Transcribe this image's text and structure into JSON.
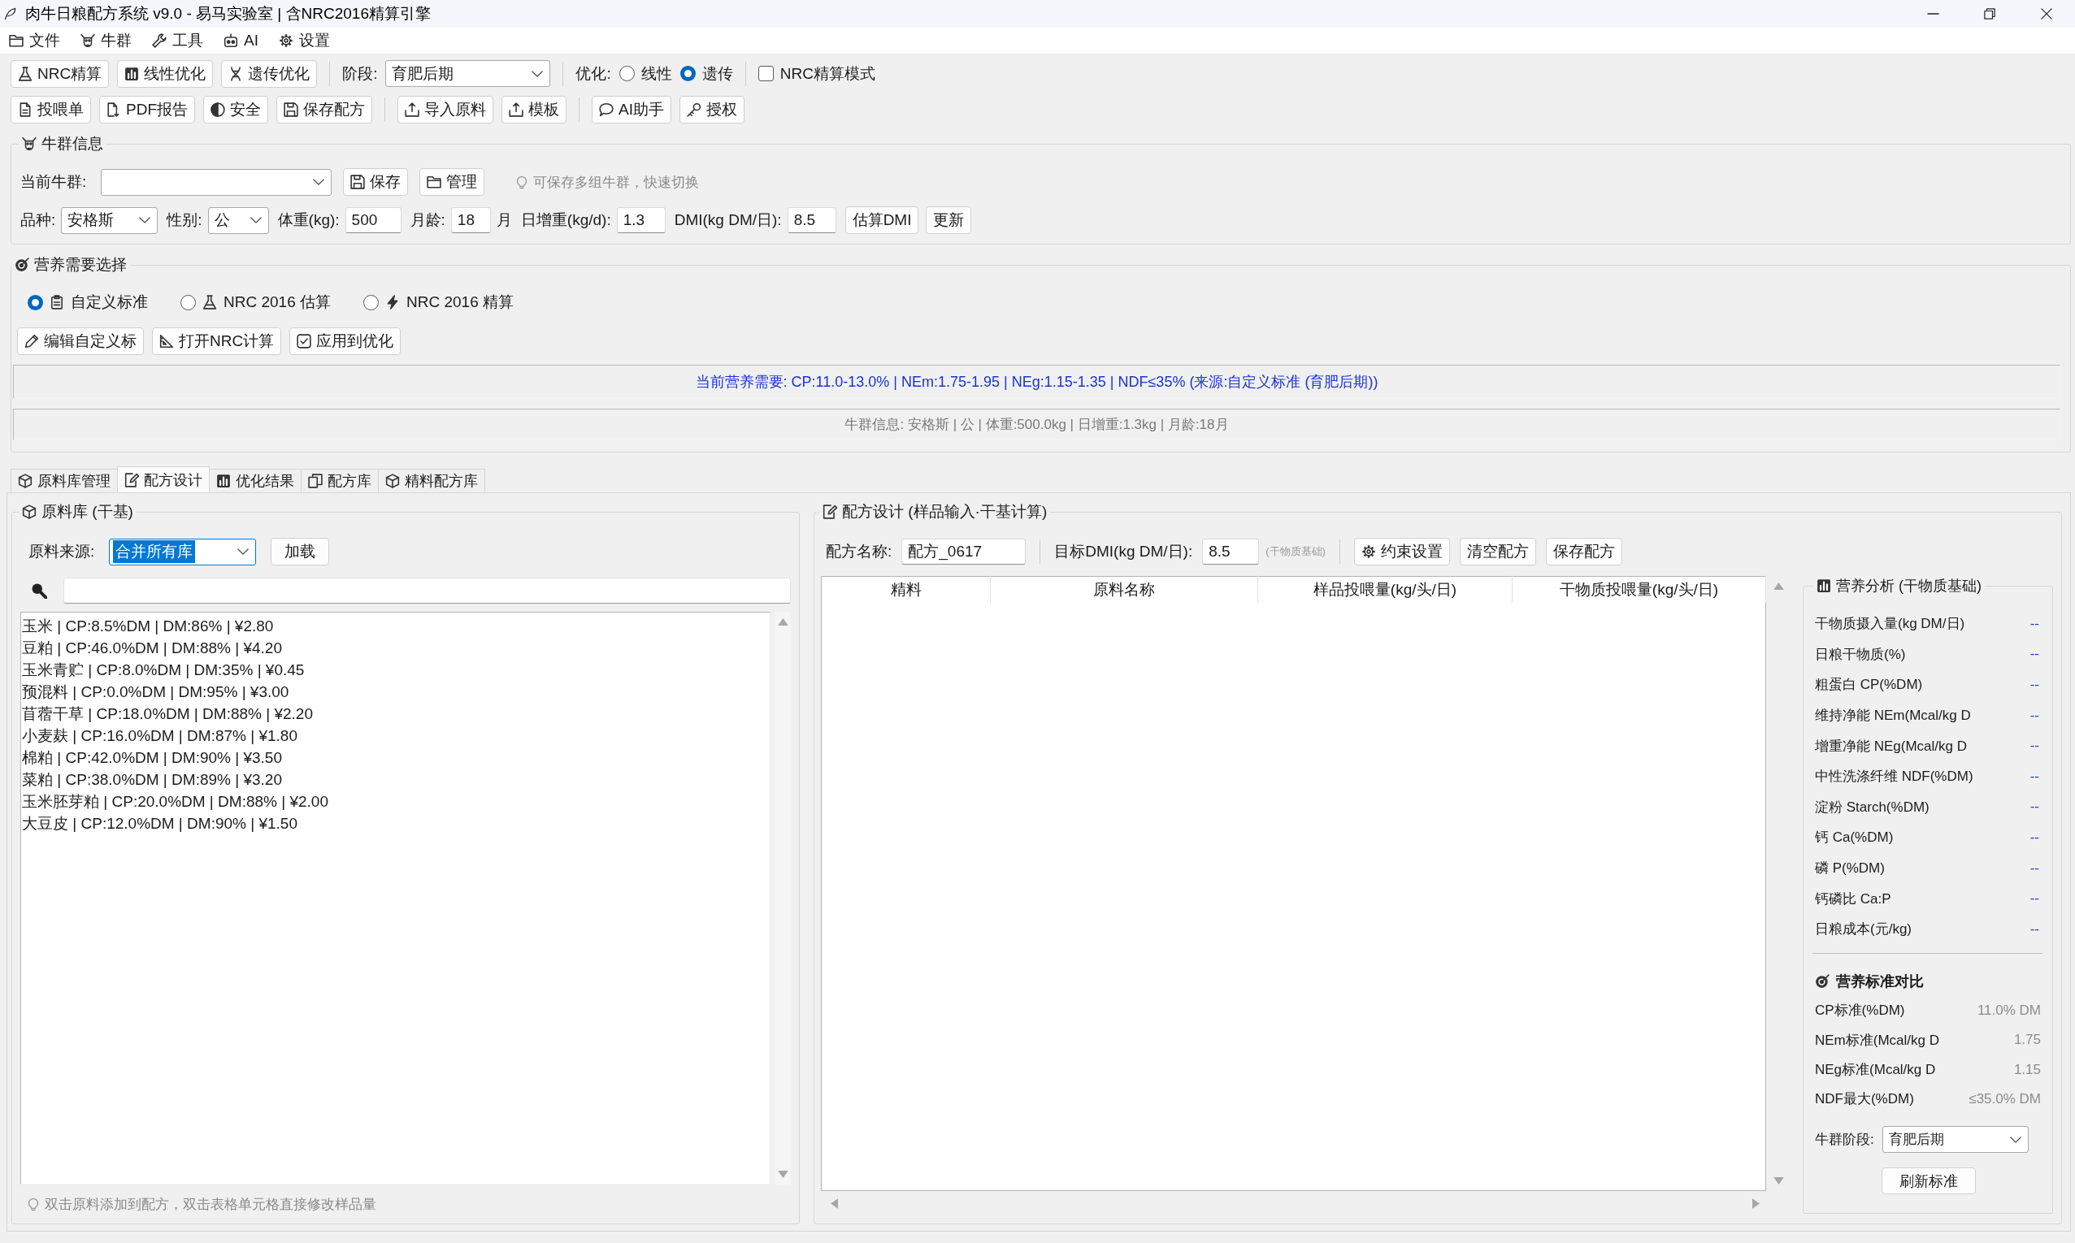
{
  "window": {
    "title": "肉牛日粮配方系统 v9.0 - 易马实验室 | 含NRC2016精算引擎"
  },
  "menu": [
    "文件",
    "牛群",
    "工具",
    "AI",
    "设置"
  ],
  "toolbar": {
    "row_1": [
      {
        "kind": "button",
        "label": "NRC精算"
      },
      {
        "kind": "button",
        "label": "线性优化"
      },
      {
        "kind": "button",
        "label": "遗传优化"
      },
      {
        "kind": "separator"
      },
      {
        "kind": "combo",
        "label": "阶段:",
        "value": "育肥后期"
      },
      {
        "kind": "separator"
      },
      {
        "kind": "radio_group",
        "label": "优化:",
        "options": [
          {
            "label": "线性",
            "selected": false
          },
          {
            "label": "遗传",
            "selected": true
          }
        ]
      },
      {
        "kind": "separator"
      },
      {
        "kind": "checkbox",
        "label": "NRC精算模式",
        "checked": false
      }
    ],
    "row_2": [
      {
        "kind": "button",
        "label": "投喂单"
      },
      {
        "kind": "button",
        "label": "PDF报告"
      },
      {
        "kind": "button",
        "label": "安全"
      },
      {
        "kind": "button",
        "label": "保存配方"
      },
      {
        "kind": "separator"
      },
      {
        "kind": "button",
        "label": "导入原料"
      },
      {
        "kind": "button",
        "label": "模板"
      },
      {
        "kind": "separator"
      },
      {
        "kind": "button",
        "label": "AI助手"
      },
      {
        "kind": "button",
        "label": "授权"
      }
    ]
  },
  "herd_info": {
    "title": "牛群信息",
    "current_herd_label": "当前牛群:",
    "buttons": [
      "保存",
      "管理"
    ],
    "hint": "可保存多组牛群，快速切换",
    "fields": [
      {
        "kind": "combo",
        "label": "品种:",
        "value": "安格斯"
      },
      {
        "kind": "combo",
        "label": "性别:",
        "value": "公"
      },
      {
        "kind": "input",
        "label": "体重(kg):",
        "value": "500"
      },
      {
        "kind": "input",
        "label": "月龄:",
        "value": "18",
        "unit": "月"
      },
      {
        "kind": "input",
        "label": "日增重(kg/d):",
        "value": "1.3"
      },
      {
        "kind": "input",
        "label": "DMI(kg DM/日):",
        "value": "8.5"
      }
    ],
    "actions": [
      "估算DMI",
      "更新"
    ]
  },
  "nutrition_selection": {
    "title": "营养需要选择",
    "sources": [
      {
        "label": "自定义标准",
        "selected": true
      },
      {
        "label": "NRC 2016 估算",
        "selected": false
      },
      {
        "label": "NRC 2016 精算",
        "selected": false
      }
    ],
    "buttons": [
      "编辑自定义标",
      "打开NRC计算",
      "应用到优化"
    ],
    "requirement_banner": "当前营养需要: CP:11.0-13.0% | NEm:1.75-1.95 | NEg:1.15-1.35 | NDF≤35% (来源:自定义标准 (育肥后期))",
    "herd_banner": "牛群信息: 安格斯 | 公 | 体重:500.0kg | 日增重:1.3kg | 月龄:18月"
  },
  "tabs": [
    {
      "label": "原料库管理",
      "selected": false
    },
    {
      "label": "配方设计",
      "selected": true
    },
    {
      "label": "优化结果",
      "selected": false
    },
    {
      "label": "配方库",
      "selected": false
    },
    {
      "label": "精料配方库",
      "selected": false
    }
  ],
  "ingredient_library": {
    "title": "原料库 (干基)",
    "source": {
      "label": "原料来源:",
      "value": "合并所有库",
      "focused": true
    },
    "load_button": "加载",
    "items": [
      "玉米 | CP:8.5%DM | DM:86% | ¥2.80",
      "豆粕 | CP:46.0%DM | DM:88% | ¥4.20",
      "玉米青贮 | CP:8.0%DM | DM:35% | ¥0.45",
      "预混料 | CP:0.0%DM | DM:95% | ¥3.00",
      "苜蓿干草 | CP:18.0%DM | DM:88% | ¥2.20",
      "小麦麸 | CP:16.0%DM | DM:87% | ¥1.80",
      "棉粕 | CP:42.0%DM | DM:90% | ¥3.50",
      "菜粕 | CP:38.0%DM | DM:89% | ¥3.20",
      "玉米胚芽粕 | CP:20.0%DM | DM:88% | ¥2.00",
      "大豆皮 | CP:12.0%DM | DM:90% | ¥1.50"
    ],
    "hint": "双击原料添加到配方，双击表格单元格直接修改样品量"
  },
  "formula_design": {
    "title": "配方设计 (样品输入·干基计算)",
    "name_label": "配方名称:",
    "name_value": "配方_0617",
    "dmi_label": "目标DMI(kg DM/日):",
    "dmi_value": "8.5",
    "dmi_note": "(干物质基础)",
    "buttons": [
      "约束设置",
      "清空配方",
      "保存配方"
    ],
    "table": {
      "columns": [
        "精料",
        "原料名称",
        "样品投喂量(kg/头/日)",
        "干物质投喂量(kg/头/日)"
      ]
    }
  },
  "nutrient_analysis": {
    "title": "营养分析 (干物质基础)",
    "rows": [
      {
        "label": "干物质摄入量(kg DM/日)",
        "value": "--"
      },
      {
        "label": "日粮干物质(%)",
        "value": "--"
      },
      {
        "label": "粗蛋白 CP(%DM)",
        "value": "--"
      },
      {
        "label": "维持净能 NEm(Mcal/kg D",
        "value": "--"
      },
      {
        "label": "增重净能 NEg(Mcal/kg D",
        "value": "--"
      },
      {
        "label": "中性洗涤纤维 NDF(%DM)",
        "value": "--"
      },
      {
        "label": "淀粉 Starch(%DM)",
        "value": "--"
      },
      {
        "label": "钙 Ca(%DM)",
        "value": "--"
      },
      {
        "label": "磷 P(%DM)",
        "value": "--"
      },
      {
        "label": "钙磷比 Ca:P",
        "value": "--"
      },
      {
        "label": "日粮成本(元/kg)",
        "value": "--"
      }
    ],
    "comparison_title": "营养标准对比",
    "comparison_rows": [
      {
        "label": "CP标准(%DM)",
        "value": "11.0% DM"
      },
      {
        "label": "NEm标准(Mcal/kg D",
        "value": "1.75"
      },
      {
        "label": "NEg标准(Mcal/kg D",
        "value": "1.15"
      },
      {
        "label": "NDF最大(%DM)",
        "value": "≤35.0% DM"
      }
    ],
    "stage_label": "牛群阶段:",
    "stage_value": "育肥后期",
    "refresh_button": "刷新标准"
  }
}
